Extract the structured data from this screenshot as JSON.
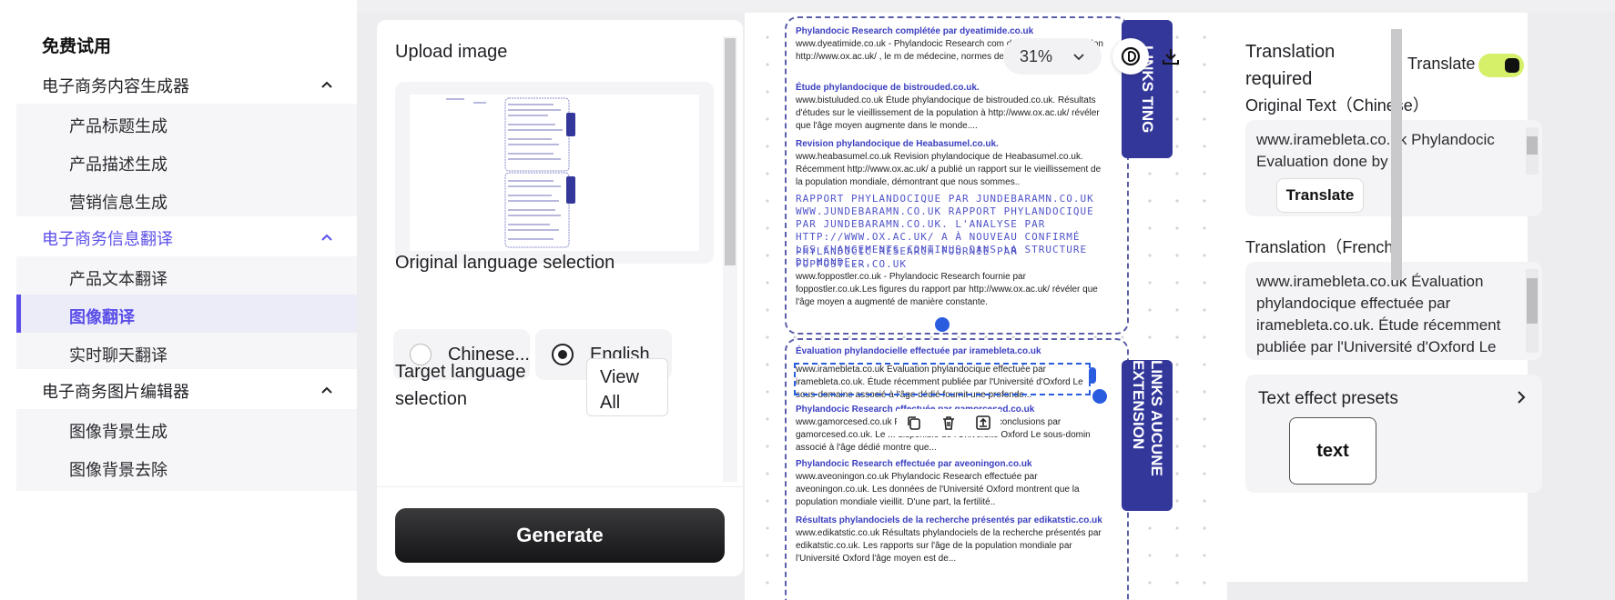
{
  "sidebar": {
    "brand": "免费试用",
    "groups": [
      {
        "label": "电子商务内容生成器",
        "items": [
          "产品标题生成",
          "产品描述生成",
          "营销信息生成"
        ]
      },
      {
        "label": "电子商务信息翻译",
        "items": [
          "产品文本翻译",
          "图像翻译",
          "实时聊天翻译"
        ]
      },
      {
        "label": "电子商务图片编辑器",
        "items": [
          "图像背景生成",
          "图像背景去除"
        ]
      }
    ],
    "active_group": "电子商务信息翻译",
    "selected_item": "图像翻译"
  },
  "config": {
    "upload_title": "Upload image",
    "original_language_title": "Original language selection",
    "original_options": [
      "Chinese...",
      "English"
    ],
    "original_selected": "English",
    "target_language_title": "Target language selection",
    "view_all": "View All",
    "generate_label": "Generate"
  },
  "canvas": {
    "zoom": "31%",
    "doc_entries": [
      {
        "title": "Phylandocic Research complétée par dyeatimide.co.uk",
        "body": "www.dyeatimide.co.uk  - Phylandocic Research com dyeatimide.co.uk. Selon http://www.ox.ac.uk/ , le m de médecine, normes de vie améliorées,..."
      },
      {
        "title": "Étude phylandocique de bistrouded.co.uk.",
        "body": "www.bistuluded.co.uk  Étude phylandocique de bistrouded.co.uk. Résultats d'études sur le vieillissement de la population à http://www.ox.ac.uk/   révéler que l'âge moyen augmente dans le monde...."
      },
      {
        "title": "Revision phylandocique de Heabasumel.co.uk.",
        "body": "www.heabasumel.co.uk  Revision phylandocique de Heabasumel.co.uk. Récemment http://www.ox.ac.uk/  a publié un rapport sur le vieillissement de la population mondiale, démontrant que nous sommes.."
      }
    ],
    "pixel_block": "RAPPORT PHYLANDOCIQUE PAR JUNDEBARAMN.CO.UK  WWW.JUNDEBARAMN.CO.UK  RAPPORT PHYLANDOCIQUE PAR JUNDEBARAMN.CO.UK. L'ANALYSE PAR HTTP://WWW.OX.AC.UK/  A À NOUVEAU CONFIRMÉ LES CHANGEMENTS CONTINUS DANS LA STRUCTURE DU MONDE...",
    "pixel_title": "PHYLANDOCIC RESEARCH FOURNIE PAR FOPPOSTLER.CO.UK",
    "pixel_body": "www.foppostler.co.uk  - Phylandocic Research fournie par foppostler.co.uk.Les figures du rapport par http://www.ox.ac.uk/ révéler que l'âge moyen a augmenté de manière constante.",
    "doc2_entries": [
      {
        "title": "Évaluation phylandocielle effectuée par iramebleta.co.uk",
        "body": "www.iramebleta.co.uk   Évaluation phylandocique effectuée par iramebleta.co.uk. Étude récemment publiée par l'Université d'Oxford Le sous-domaine associé à l'âge dédié fournit une profonde..."
      },
      {
        "title": "Phylandocic Research effectuée par gamorcesed.co.uk",
        "body": "www.gamorcesed.co.uk  Phylandocic Research ... conclusions par gamorcesed.co.uk. Le ... disponible de l'Université Oxford Le sous-domin associé à l'âge dédié montre que..."
      },
      {
        "title": "Phylandocic Research effectuée par aveoningon.co.uk",
        "body": "www.aveoningon.co.uk   Phylandocic Research effectuée par aveoningon.co.uk. Les données de l'Université Oxford montrent que la population mondiale vieillit. D'une part, la fertilité.."
      },
      {
        "title": "Résultats phylandociels de la recherche présentés par edikatstic.co.uk",
        "body": "www.edikatstic.co.uk   Résultats phylandociels de la recherche présentés par edikatstic.co.uk. Les rapports sur l'âge de la population mondiale par l'Université Oxford l'âge moyen est de..."
      }
    ],
    "tag1": "LINKS TING",
    "tag2": "LINKS AUCUNE EXTENSION"
  },
  "right_panel": {
    "title": "Translation required",
    "toggle_label": "Translate",
    "toggle_on": true,
    "original_label": "Original Text（Chinese）",
    "original_text": "www.iramebleta.co.uk Phylandocic Evaluation done by",
    "translate_button": "Translate",
    "translation_label": "Translation（French）",
    "translation_text": "www.iramebleta.co.uk   Évaluation phylandocique effectuée par iramebleta.co.uk. Étude récemment publiée par l'Université d'Oxford Le",
    "presets_title": "Text effect presets",
    "preset_tile": "text"
  },
  "colors": {
    "accent": "#5b4fe8",
    "toggle": "#d6f06a",
    "doc_title": "#3a3ec0",
    "tag_bg": "#33379a"
  }
}
